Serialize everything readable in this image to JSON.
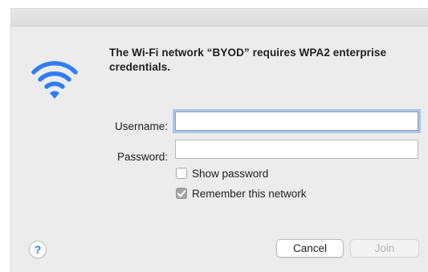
{
  "dialog": {
    "message": "The Wi-Fi network “BYOD” requires WPA2 enterprise credentials.",
    "icon": "wifi-icon",
    "accent_color": "#2f7df6"
  },
  "form": {
    "username": {
      "label": "Username:",
      "value": ""
    },
    "password": {
      "label": "Password:",
      "value": ""
    },
    "show_password": {
      "label": "Show password",
      "checked": false
    },
    "remember_network": {
      "label": "Remember this network",
      "checked": true
    }
  },
  "buttons": {
    "help_label": "?",
    "cancel_label": "Cancel",
    "join_label": "Join"
  }
}
